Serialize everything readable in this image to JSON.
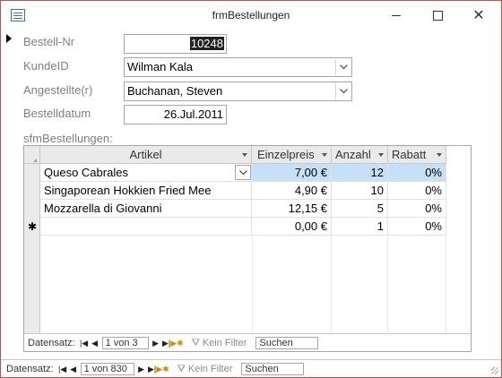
{
  "window": {
    "title": "frmBestellungen"
  },
  "form": {
    "bestell_nr": {
      "label": "Bestell-Nr",
      "value": "10248"
    },
    "kunde_id": {
      "label": "KundeID",
      "value": "Wilman Kala"
    },
    "angestellte": {
      "label": "Angestellte(r)",
      "value": "Buchanan, Steven"
    },
    "bestelldatum": {
      "label": "Bestelldatum",
      "value": "26.Jul.2011"
    }
  },
  "subform": {
    "label": "sfmBestellungen:",
    "columns": {
      "artikel": "Artikel",
      "einzelpreis": "Einzelpreis",
      "anzahl": "Anzahl",
      "rabatt": "Rabatt"
    },
    "rows": [
      {
        "artikel": "Queso Cabrales",
        "einzelpreis": "7,00 €",
        "anzahl": "12",
        "rabatt": "0%"
      },
      {
        "artikel": "Singaporean Hokkien Fried Mee",
        "einzelpreis": "4,90 €",
        "anzahl": "10",
        "rabatt": "0%"
      },
      {
        "artikel": "Mozzarella di Giovanni",
        "einzelpreis": "12,15 €",
        "anzahl": "5",
        "rabatt": "0%"
      }
    ],
    "new_row": {
      "marker": "✱",
      "einzelpreis": "0,00 €",
      "anzahl": "1",
      "rabatt": "0%"
    },
    "nav": {
      "label": "Datensatz:",
      "position": "1 von 3",
      "filter": "Kein Filter",
      "search": "Suchen"
    }
  },
  "main_nav": {
    "label": "Datensatz:",
    "position": "1 von 830",
    "filter": "Kein Filter",
    "search": "Suchen"
  },
  "colors": {
    "highlight": "#c5e0f7",
    "title_border": "#c0504d",
    "label": "#7f7f7f"
  },
  "icons": [
    "form-icon",
    "minimize-icon",
    "maximize-icon",
    "close-icon",
    "chevron-down-icon",
    "record-pointer-icon",
    "new-record-icon",
    "first-record-icon",
    "previous-record-icon",
    "next-record-icon",
    "last-record-icon",
    "new-record-nav-icon",
    "filter-icon"
  ]
}
